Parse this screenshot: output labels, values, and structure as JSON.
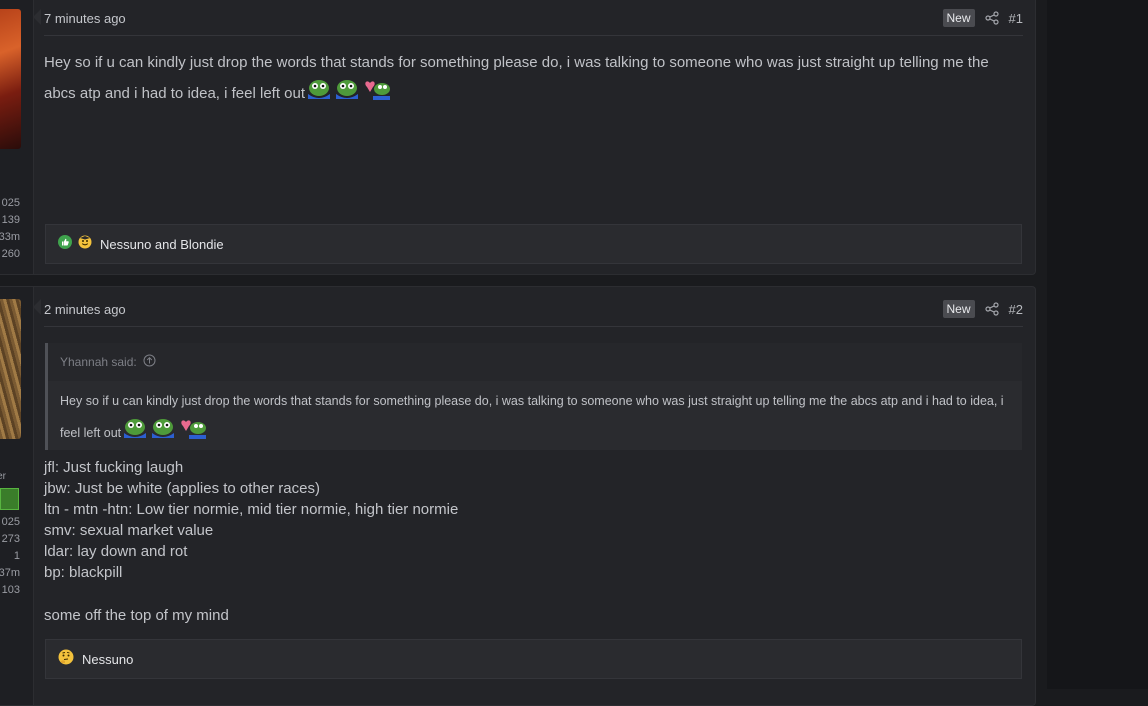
{
  "posts": [
    {
      "time": "7 minutes ago",
      "new_label": "New",
      "number": "#1",
      "share_icon": "share-icon",
      "stats": [
        "025",
        "139",
        "33m",
        "260"
      ],
      "text": "Hey so if u can kindly just drop the words that stands for something please do, i was talking to someone who was just straight up telling me the abcs atp and i had to idea, i feel left out",
      "reactions": {
        "icons": [
          "like-icon",
          "cheers-icon"
        ],
        "names": "Nessuno and Blondie"
      }
    },
    {
      "time": "2 minutes ago",
      "new_label": "New",
      "number": "#2",
      "share_icon": "share-icon",
      "user_label": "er",
      "stats": [
        "025",
        "273",
        "1",
        "37m",
        "103"
      ],
      "quote": {
        "author": "Yhannah said:",
        "text": "Hey so if u can kindly just drop the words that stands for something please do, i was talking to someone who was just straight up telling me the abcs atp and i had to idea, i feel left out"
      },
      "lines": [
        "jfl: Just fucking laugh",
        "jbw: Just be white (applies to other races)",
        "ltn - mtn -htn: Low tier normie, mid tier normie, high tier normie",
        "smv: sexual market value",
        "ldar: lay down and rot",
        "bp: blackpill"
      ],
      "closing": "some off the top of my mind",
      "reactions": {
        "icons": [
          "thinking-icon"
        ],
        "names": "Nessuno"
      }
    }
  ],
  "colors": {
    "background": "#1a1b1e",
    "post_bg": "#232428",
    "text": "#c0c2c7"
  }
}
